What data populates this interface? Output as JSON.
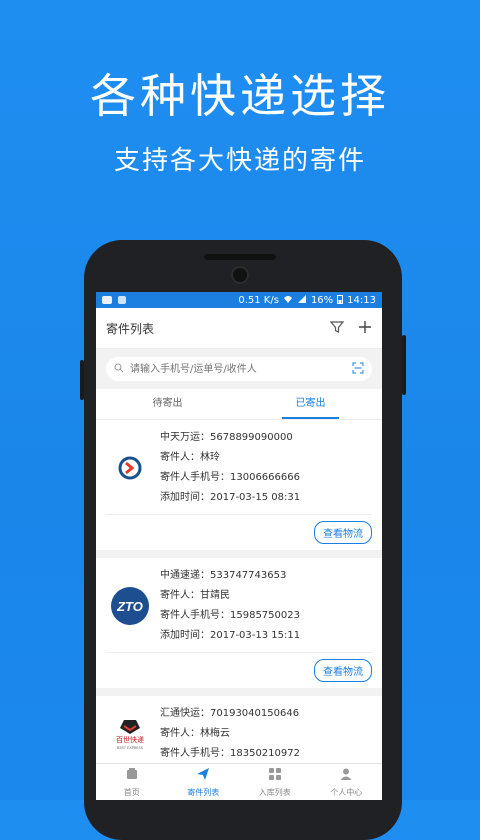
{
  "promo": {
    "title": "各种快递选择",
    "subtitle": "支持各大快递的寄件"
  },
  "status_bar": {
    "speed": "0.51 K/s",
    "battery": "16%",
    "time": "14:13"
  },
  "appbar": {
    "title": "寄件列表",
    "filter_icon": "filter-icon",
    "add_icon": "plus-icon"
  },
  "search": {
    "placeholder": "请输入手机号/运单号/收件人",
    "scan_icon": "scan-icon"
  },
  "tabs": [
    {
      "label": "待寄出",
      "active": false
    },
    {
      "label": "已寄出",
      "active": true
    }
  ],
  "shipments": [
    {
      "logo": "zhongtian-wanyun-logo",
      "tracking": "中天万运：5678899090000",
      "sender": "寄件人：林玲",
      "phone": "寄件人手机号：13006666666",
      "added": "添加时间：2017-03-15 08:31",
      "action": "查看物流"
    },
    {
      "logo": "zto-logo",
      "tracking": "中通速递：533747743653",
      "sender": "寄件人：甘靖民",
      "phone": "寄件人手机号：15985750023",
      "added": "添加时间：2017-03-13 15:11",
      "action": "查看物流"
    },
    {
      "logo": "best-express-logo",
      "tracking": "汇通快运：70193040150646",
      "sender": "寄件人：林梅云",
      "phone": "寄件人手机号：18350210972",
      "added": "",
      "action": ""
    }
  ],
  "bottom_nav": [
    {
      "label": "首页",
      "icon": "home-icon",
      "active": false
    },
    {
      "label": "寄件列表",
      "icon": "send-icon",
      "active": true
    },
    {
      "label": "入库列表",
      "icon": "grid-icon",
      "active": false
    },
    {
      "label": "个人中心",
      "icon": "user-icon",
      "active": false
    }
  ],
  "logos": {
    "zto_text": "ZTO",
    "best_text": "百世快递",
    "best_sub": "BEST EXPRESS"
  },
  "colors": {
    "background": "#1f8ef1",
    "accent": "#1a7fe0",
    "zto_blue": "#1d4e8f"
  }
}
